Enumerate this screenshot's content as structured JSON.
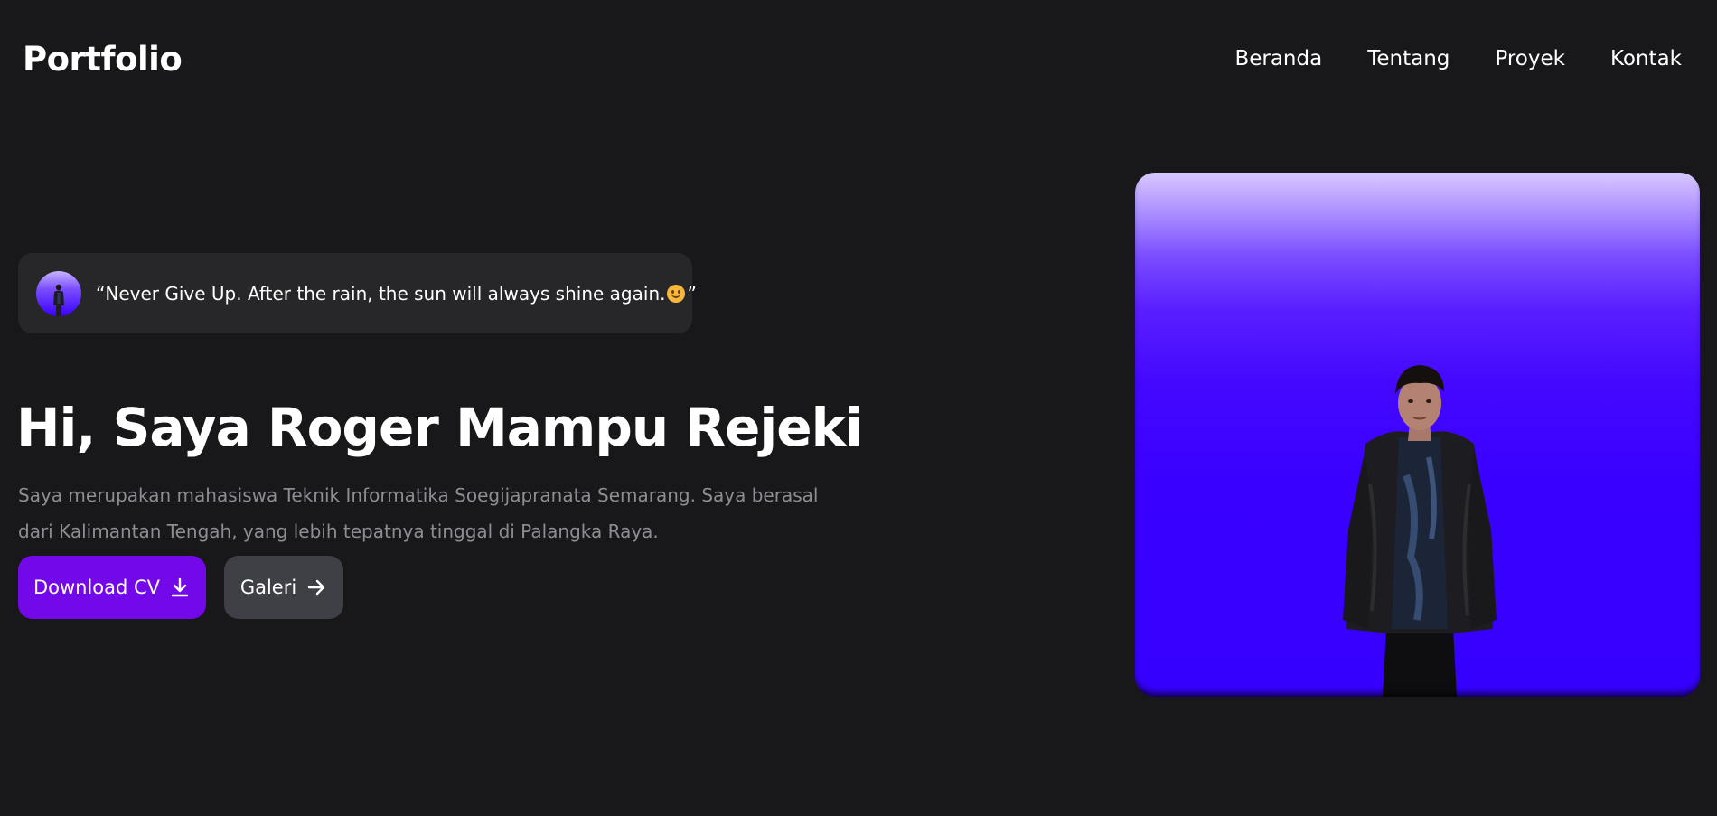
{
  "header": {
    "logo": "Portfolio",
    "nav": [
      {
        "label": "Beranda"
      },
      {
        "label": "Tentang"
      },
      {
        "label": "Proyek"
      },
      {
        "label": "Kontak"
      }
    ]
  },
  "hero": {
    "quote": {
      "open_mark": "“",
      "text": "Never Give Up. After the rain, the sun will always shine again.",
      "emoji": "smiling-face-icon",
      "close_mark": "”"
    },
    "headline": "Hi, Saya Roger Mampu Rejeki",
    "description": "Saya merupakan mahasiswa Teknik Informatika Soegijapranata Semarang. Saya berasal dari Kalimantan Tengah, yang lebih tepatnya tinggal di Palangka Raya.",
    "buttons": {
      "download_cv": {
        "label": "Download CV",
        "icon": "download-icon"
      },
      "gallery": {
        "label": "Galeri",
        "icon": "arrow-right-icon"
      }
    }
  },
  "colors": {
    "background": "#18181b",
    "card": "#27272a",
    "primary": "#7308e8",
    "secondary": "#3f3f46",
    "muted_text": "#8d8d93",
    "hero_gradient_top": "#d8c8ff",
    "hero_gradient_bottom": "#3600ff"
  }
}
